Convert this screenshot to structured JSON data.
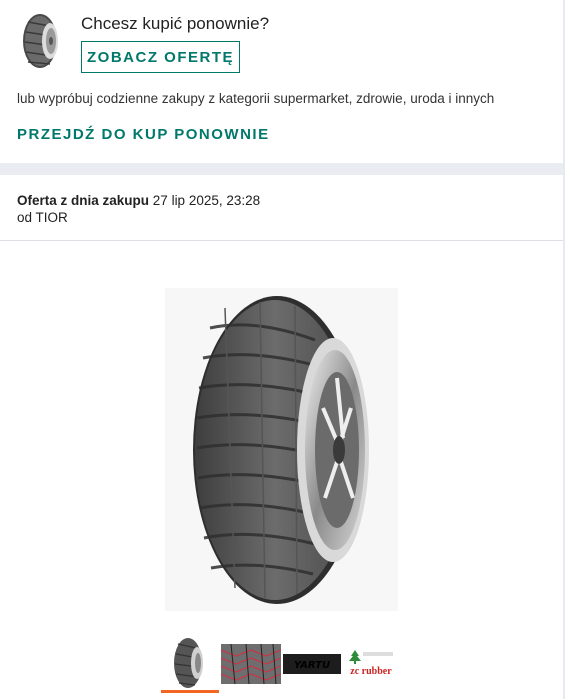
{
  "buy_again": {
    "title": "Chcesz kupić ponownie?",
    "offer_button": "ZOBACZ OFERTĘ",
    "categories_text": "lub wypróbuj codzienne zakupy z kategorii supermarket, zdrowie, uroda i innych",
    "goto_link": "PRZEJDŹ DO KUP PONOWNIE"
  },
  "offer": {
    "date_label": "Oferta z dnia zakupu",
    "date_value": "27 lip 2025, 23:28",
    "seller": "od TIOR"
  },
  "gallery": {
    "main_image": "tire-photo",
    "thumbnails": [
      {
        "name": "tire-photo",
        "active": true
      },
      {
        "name": "tread-pattern"
      },
      {
        "name": "yartu-logo",
        "text": "YARTU"
      },
      {
        "name": "zc-rubber-logo",
        "text": "zc rubber"
      }
    ]
  },
  "colors": {
    "accent": "#00796b",
    "active_thumb": "#f26522",
    "divider": "#e9edf1"
  }
}
